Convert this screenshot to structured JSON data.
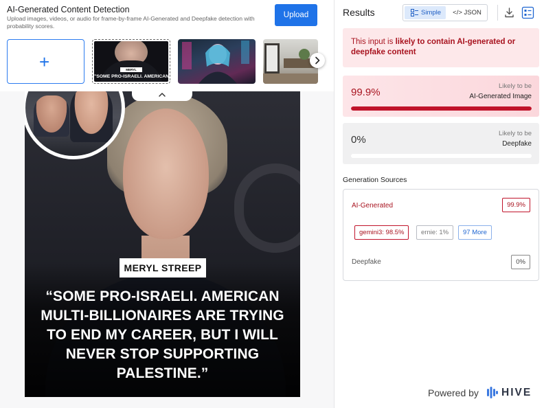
{
  "app": {
    "title": "AI-Generated Content Detection",
    "subtitle": "Upload images, videos, or audio for frame-by-frame AI-Generated and Deepfake detection with probability scores.",
    "upload_label": "Upload"
  },
  "thumbnails": {
    "add_symbol": "+",
    "selected_caption_tag": "MERYL STREEP",
    "selected_caption_text": "\"SOME PRO-ISRAELI. AMERICAN"
  },
  "preview": {
    "name_tag": "MERYL STREEP",
    "quote": "“SOME PRO-ISRAELI. AMERICAN MULTI-BILLIONAIRES ARE TRYING TO END MY CAREER, BUT I WILL NEVER STOP SUPPORTING PALESTINE.”"
  },
  "results": {
    "title": "Results",
    "view_simple": "Simple",
    "view_json": "</> JSON",
    "banner_prefix": "This input is ",
    "banner_strong": "likely to contain AI-generated or deepfake content",
    "ai_card": {
      "percent": "99.9%",
      "label_top": "Likely to be",
      "label_main": "AI-Generated Image",
      "level": 0.999
    },
    "deepfake_card": {
      "percent": "0%",
      "label_top": "Likely to be",
      "label_main": "Deepfake",
      "level": 0.0
    },
    "generation_title": "Generation Sources",
    "ai_generated_label": "AI-Generated",
    "ai_generated_value": "99.9%",
    "chips": [
      "gemini3: 98.5%",
      "ernie: 1%",
      "97 More"
    ],
    "deepfake_label": "Deepfake",
    "deepfake_value": "0%"
  },
  "footer": {
    "powered_by": "Powered by",
    "brand": "HIVE"
  },
  "colors": {
    "accent_blue": "#1f73e8",
    "alert_red": "#a8131f",
    "bar_red": "#c0132a"
  }
}
